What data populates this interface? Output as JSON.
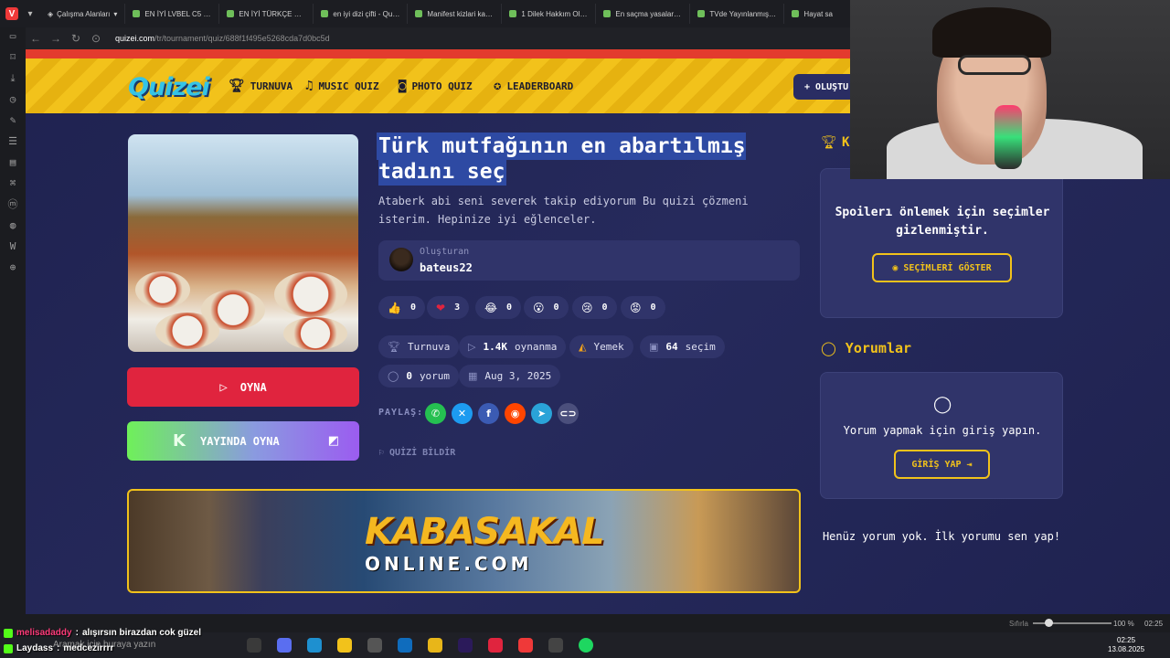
{
  "browser": {
    "workspace_label": "Çalışma Alanları",
    "tabs": [
      "EN İYİ LVBEL C5 ŞARKI",
      "EN İYİ TÜRKÇE ŞARKI 2",
      "en iyi dizi çifti - Quizei",
      "Manifest kizlari karsilas",
      "1 Dilek Hakkım Olsa - C",
      "En saçma yasalar - Qui",
      "TVde Yayınlanmış En İy",
      "Hayat sa"
    ],
    "url_domain": "quizei.com",
    "url_path": "/tr/tournament/quiz/688f1f495e5268cda7d0bc5d"
  },
  "site": {
    "logo": "Quizei",
    "nav": [
      {
        "icon": "trophy-icon",
        "label": "TURNUVA"
      },
      {
        "icon": "music-note-icon",
        "label": "MUSIC QUIZ"
      },
      {
        "icon": "camera-icon",
        "label": "PHOTO QUIZ"
      },
      {
        "icon": "medal-icon",
        "label": "LEADERBOARD"
      }
    ],
    "create_label": "+ OLUŞTU",
    "accent": "#f1c21b",
    "header_red": "#e33b2e"
  },
  "quiz": {
    "title": "Türk mutfağının en abartılmış tadını seç",
    "description": "Ataberk abi seni severek takip ediyorum Bu quizi çözmeni isterim. Hepinize iyi eğlenceler.",
    "creator_label": "Oluşturan",
    "creator_name": "bateus22",
    "play_label": "OYNA",
    "stream_label": "YAYINDA OYNA",
    "reactions": [
      {
        "icon": "thumbs-up-icon",
        "glyph": "👍",
        "count": "0"
      },
      {
        "icon": "heart-icon",
        "glyph": "❤",
        "count": "3"
      },
      {
        "icon": "laugh-icon",
        "glyph": "😂",
        "count": "0"
      },
      {
        "icon": "surprised-icon",
        "glyph": "😮",
        "count": "0"
      },
      {
        "icon": "sad-icon",
        "glyph": "😢",
        "count": "0"
      },
      {
        "icon": "angry-icon",
        "glyph": "😡",
        "count": "0"
      }
    ],
    "meta": {
      "type": "Turnuva",
      "plays_count": "1.4K",
      "plays_label": "oynanma",
      "category": "Yemek",
      "choices_count": "64",
      "choices_label": "seçim",
      "comments_count": "0",
      "comments_label": "yorum",
      "date": "Aug 3, 2025"
    },
    "share_label": "PAYLAŞ:",
    "report_label": "QUİZİ BİLDİR"
  },
  "ad": {
    "top": "KABASAKAL",
    "bottom": "ONLINE.COM"
  },
  "sidebar_right": {
    "results_letter": "K",
    "spoiler_text": "Spoilerı önlemek için seçimler gizlenmiştir.",
    "show_choices_label": "SEÇİMLERİ GÖSTER",
    "comments_title": "Yorumlar",
    "login_prompt": "Yorum yapmak için giriş yapın.",
    "login_button": "GİRİŞ YAP",
    "no_comments": "Henüz yorum yok. İlk yorumu sen yap!"
  },
  "status": {
    "reset_label": "Sıfırla",
    "zoom": "100 %",
    "time": "02:25"
  },
  "chat": [
    {
      "user": "melisadaddy",
      "text": "alışırsın birazdan cok güzel"
    },
    {
      "user": "Laydass",
      "text": "medcezirrrr"
    }
  ],
  "taskbar": {
    "search_placeholder": "Aramak için buraya yazın",
    "tray_time": "02:25",
    "tray_date": "13.08.2025"
  }
}
